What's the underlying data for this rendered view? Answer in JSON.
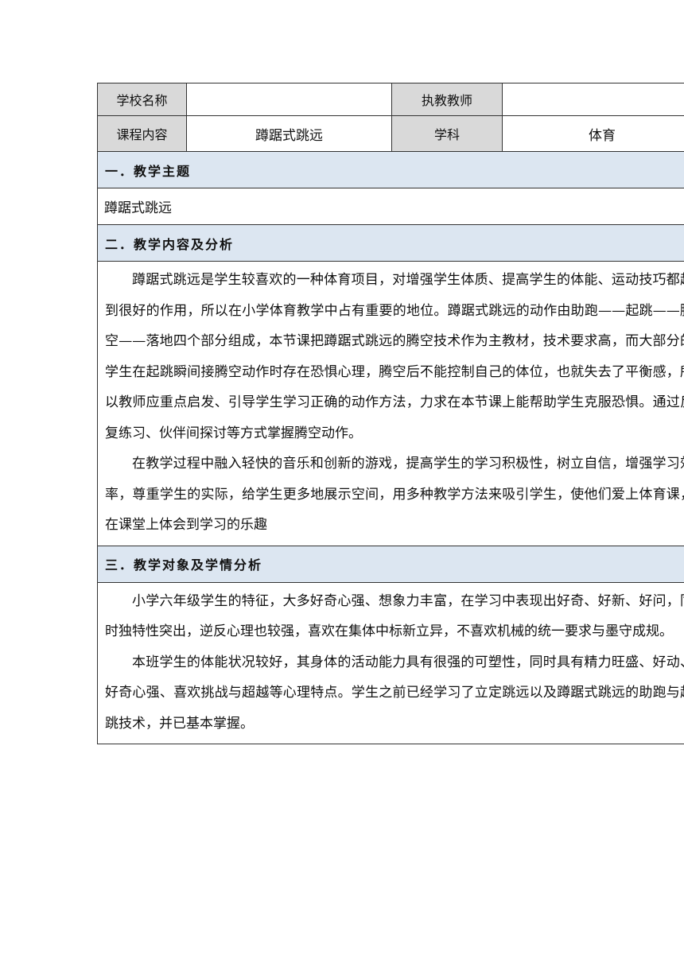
{
  "info_table": {
    "school_label": "学校名称",
    "school_value": "",
    "teacher_label": "执教教师",
    "teacher_value": "",
    "course_label": "课程内容",
    "course_value": "蹲踞式跳远",
    "subject_label": "学科",
    "subject_value": "体育"
  },
  "sections": {
    "s1": {
      "title": "一．教学主题",
      "text": "蹲踞式跳远"
    },
    "s2": {
      "title": "二．教学内容及分析",
      "p1": "蹲踞式跳远是学生较喜欢的一种体育项目，对增强学生体质、提高学生的体能、运动技巧都起到很好的作用，所以在小学体育教学中占有重要的地位。蹲踞式跳远的动作由助跑——起跳——腾空——落地四个部分组成，本节课把蹲踞式跳远的腾空技术作为主教材，技术要求高，而大部分的学生在起跳瞬间接腾空动作时存在恐惧心理，腾空后不能控制自己的体位，也就失去了平衡感，所以教师应重点启发、引导学生学习正确的动作方法，力求在本节课上能帮助学生克服恐惧。通过反复练习、伙伴间探讨等方式掌握腾空动作。",
      "p2": "在教学过程中融入轻快的音乐和创新的游戏，提高学生的学习积极性，树立自信，增强学习效率，尊重学生的实际，给学生更多地展示空间，用多种教学方法来吸引学生，使他们爱上体育课，在课堂上体会到学习的乐趣"
    },
    "s3": {
      "title": "三．教学对象及学情分析",
      "p1": "小学六年级学生的特征，大多好奇心强、想象力丰富，在学习中表现出好奇、好新、好问，同时独特性突出，逆反心理也较强，喜欢在集体中标新立异，不喜欢机械的统一要求与墨守成规。",
      "p2": "本班学生的体能状况较好，其身体的活动能力具有很强的可塑性，同时具有精力旺盛、好动、好奇心强、喜欢挑战与超越等心理特点。学生之前已经学习了立定跳远以及蹲踞式跳远的助跑与起跳技术，并已基本掌握。"
    }
  }
}
